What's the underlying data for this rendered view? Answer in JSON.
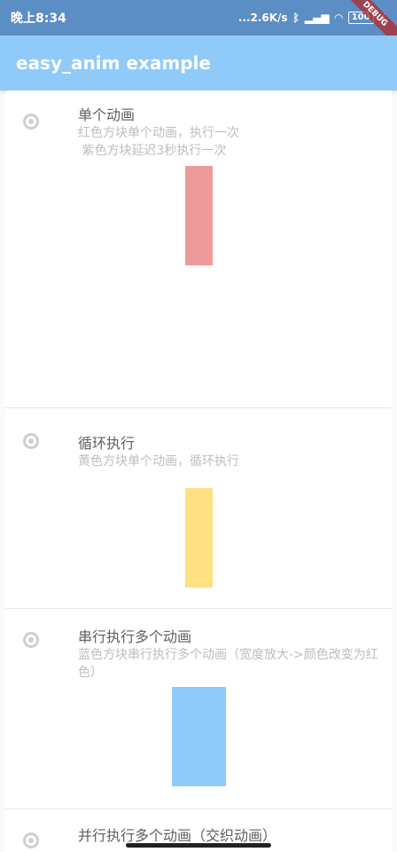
{
  "status_bar": {
    "time": "晚上8:34",
    "network_speed": "...2.6K/s",
    "battery": "100",
    "debug_label": "DEBUG"
  },
  "app_bar": {
    "title": "easy_anim example"
  },
  "cards": [
    {
      "title": "单个动画",
      "desc_line1": "红色方块单个动画，执行一次",
      "desc_line2": " 紫色方块延迟3秒执行一次",
      "box_color": "#ef9a9a"
    },
    {
      "title": "循环执行",
      "desc_line1": "黄色方块单个动画，循环执行",
      "box_color": "#ffe082"
    },
    {
      "title": "串行执行多个动画",
      "desc_line1": "蓝色方块串行执行多个动画（宽度放大->颜色改变为红色）",
      "box_color": "#90caf9"
    },
    {
      "title": "并行执行多个动画（交织动画）"
    }
  ]
}
